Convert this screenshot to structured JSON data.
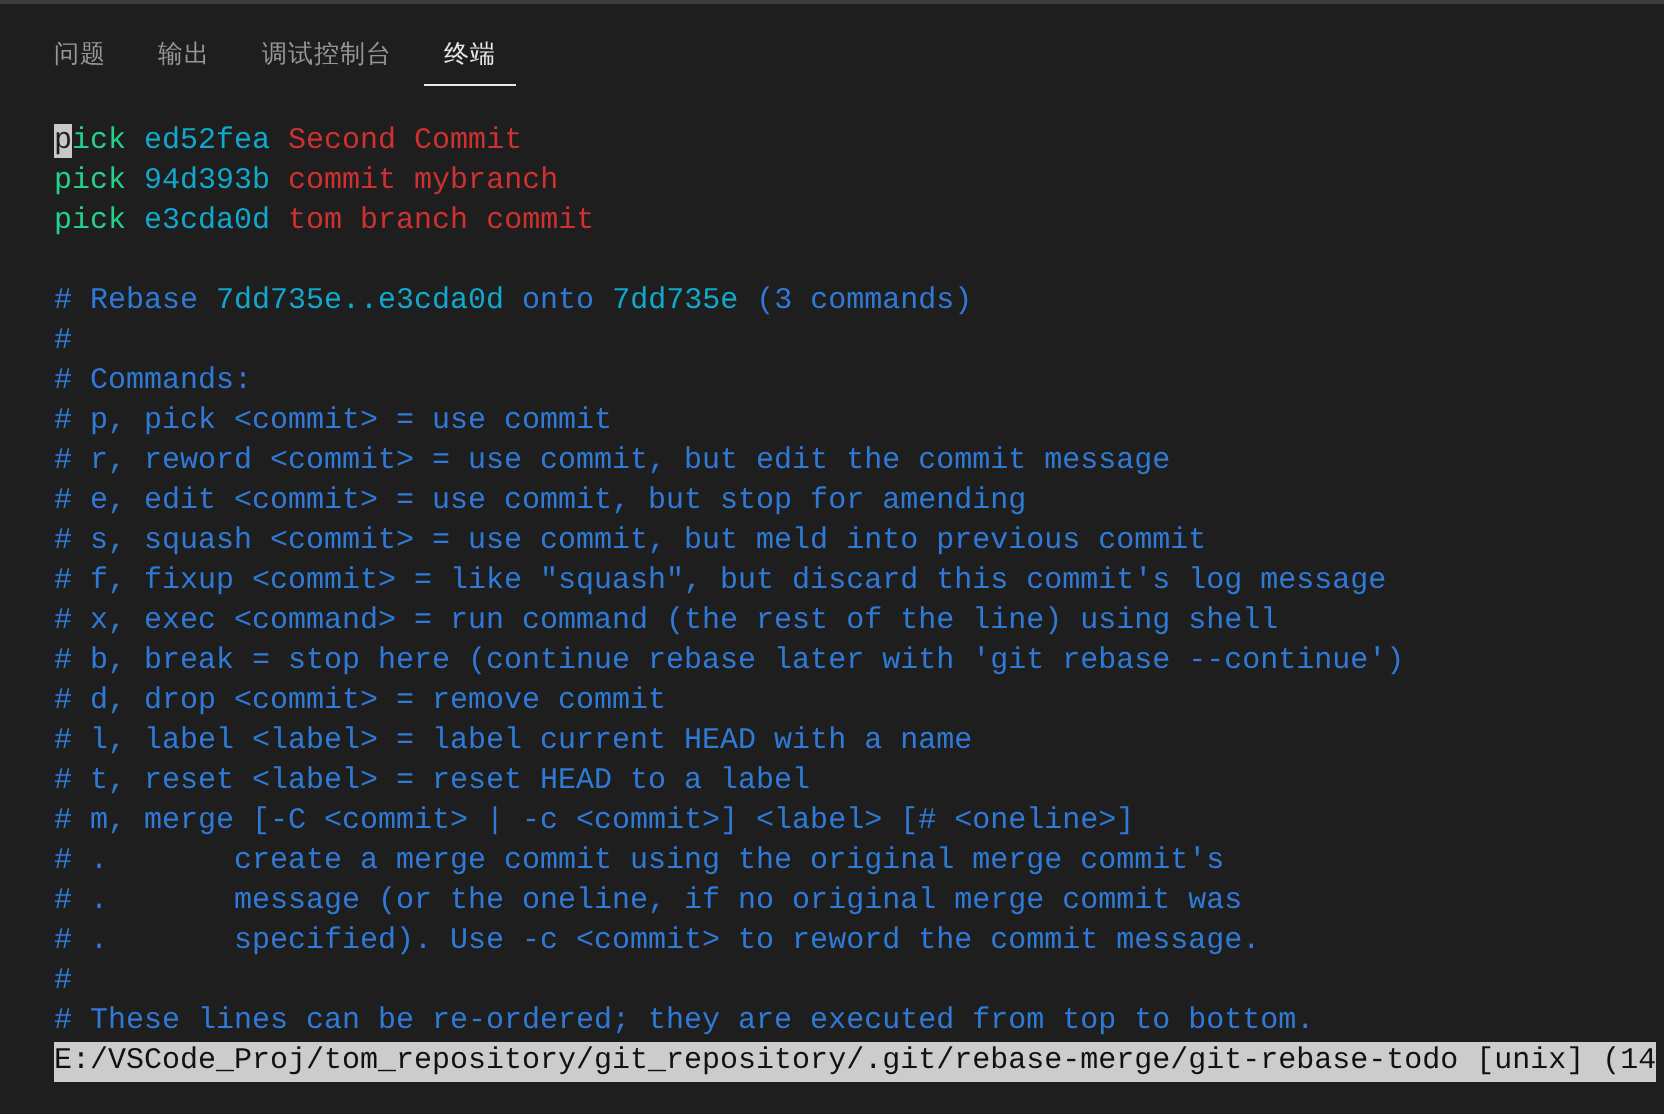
{
  "tabs": [
    {
      "label": "问题",
      "selected": false
    },
    {
      "label": "输出",
      "selected": false
    },
    {
      "label": "调试控制台",
      "selected": false
    },
    {
      "label": "终端",
      "selected": true
    }
  ],
  "editor": {
    "lines": [
      {
        "kind": "todo",
        "cursor": true,
        "command": "pick",
        "hash": "ed52fea",
        "message": "Second Commit"
      },
      {
        "kind": "todo",
        "cursor": false,
        "command": "pick",
        "hash": "94d393b",
        "message": "commit mybranch"
      },
      {
        "kind": "todo",
        "cursor": false,
        "command": "pick",
        "hash": "e3cda0d",
        "message": "tom branch commit"
      },
      {
        "kind": "blank"
      },
      {
        "kind": "code",
        "segments": [
          {
            "text": "# Rebase ",
            "kind": "comment"
          },
          {
            "text": "7dd735e..e3cda0d",
            "kind": "hash"
          },
          {
            "text": " onto ",
            "kind": "comment"
          },
          {
            "text": "7dd735e",
            "kind": "hash"
          },
          {
            "text": " (3 commands)",
            "kind": "comment"
          }
        ]
      },
      {
        "kind": "code",
        "segments": [
          {
            "text": "#",
            "kind": "comment"
          }
        ]
      },
      {
        "kind": "code",
        "segments": [
          {
            "text": "# Commands:",
            "kind": "comment"
          }
        ]
      },
      {
        "kind": "code",
        "segments": [
          {
            "text": "# p, pick <commit> = use commit",
            "kind": "comment"
          }
        ]
      },
      {
        "kind": "code",
        "segments": [
          {
            "text": "# r, reword <commit> = use commit, but edit the commit message",
            "kind": "comment"
          }
        ]
      },
      {
        "kind": "code",
        "segments": [
          {
            "text": "# e, edit <commit> = use commit, but stop for amending",
            "kind": "comment"
          }
        ]
      },
      {
        "kind": "code",
        "segments": [
          {
            "text": "# s, squash <commit> = use commit, but meld into previous commit",
            "kind": "comment"
          }
        ]
      },
      {
        "kind": "code",
        "segments": [
          {
            "text": "# f, fixup <commit> = like \"squash\", but discard this commit's log message",
            "kind": "comment"
          }
        ]
      },
      {
        "kind": "code",
        "segments": [
          {
            "text": "# x, exec <command> = run command (the rest of the line) using shell",
            "kind": "comment"
          }
        ]
      },
      {
        "kind": "code",
        "segments": [
          {
            "text": "# b, break = stop here (continue rebase later with 'git rebase --continue')",
            "kind": "comment"
          }
        ]
      },
      {
        "kind": "code",
        "segments": [
          {
            "text": "# d, drop <commit> = remove commit",
            "kind": "comment"
          }
        ]
      },
      {
        "kind": "code",
        "segments": [
          {
            "text": "# l, label <label> = label current HEAD with a name",
            "kind": "comment"
          }
        ]
      },
      {
        "kind": "code",
        "segments": [
          {
            "text": "# t, reset <label> = reset HEAD to a label",
            "kind": "comment"
          }
        ]
      },
      {
        "kind": "code",
        "segments": [
          {
            "text": "# m, merge [-C <commit> | -c <commit>] <label> [# <oneline>]",
            "kind": "comment"
          }
        ]
      },
      {
        "kind": "code",
        "segments": [
          {
            "text": "# .       create a merge commit using the original merge commit's",
            "kind": "comment"
          }
        ]
      },
      {
        "kind": "code",
        "segments": [
          {
            "text": "# .       message (or the oneline, if no original merge commit was",
            "kind": "comment"
          }
        ]
      },
      {
        "kind": "code",
        "segments": [
          {
            "text": "# .       specified). Use -c <commit> to reword the commit message.",
            "kind": "comment"
          }
        ]
      },
      {
        "kind": "code",
        "segments": [
          {
            "text": "#",
            "kind": "comment"
          }
        ]
      },
      {
        "kind": "code",
        "segments": [
          {
            "text": "# These lines can be re-ordered; they are executed from top to bottom.",
            "kind": "comment"
          }
        ]
      }
    ],
    "status_line": "E:/VSCode_Proj/tom_repository/git_repository/.git/rebase-merge/git-rebase-todo [unix] (14"
  }
}
